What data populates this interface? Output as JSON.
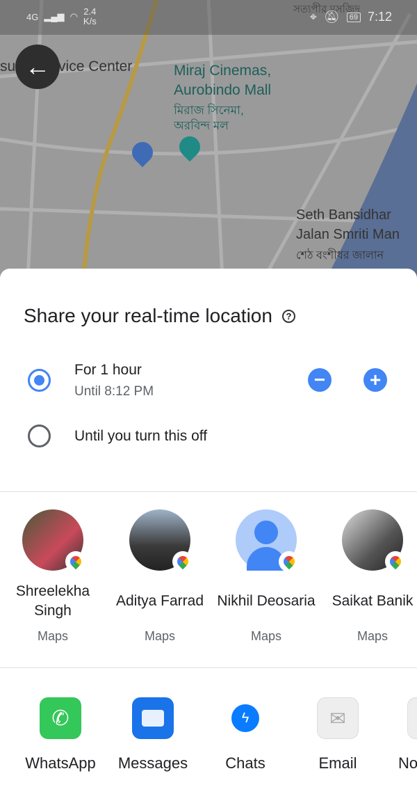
{
  "status_bar": {
    "network": "4G",
    "speed": "2.4",
    "speed_unit": "K/s",
    "battery": "69",
    "time": "7:12"
  },
  "map": {
    "labels": [
      "sung Service Center",
      "Miraj Cinemas,",
      "Aurobindo Mall",
      "মিরাজ সিনেমা,",
      "অরবিন্দ মল",
      "Seth Bansidhar",
      "Jalan Smriti Man",
      "শেঠ বংশীধর জালান",
      "সত্যপীর মসজিদ"
    ]
  },
  "sheet": {
    "title": "Share your real-time location",
    "options": [
      {
        "label": "For 1 hour",
        "sublabel": "Until 8:12 PM",
        "selected": true
      },
      {
        "label": "Until you turn this off",
        "selected": false
      }
    ],
    "contacts": [
      {
        "name": "Shreelekha Singh",
        "app": "Maps"
      },
      {
        "name": "Aditya Farrad",
        "app": "Maps"
      },
      {
        "name": "Nikhil Deosaria",
        "app": "Maps"
      },
      {
        "name": "Saikat Banik",
        "app": "Maps"
      }
    ],
    "apps": [
      {
        "name": "WhatsApp",
        "color": "#34c759"
      },
      {
        "name": "Messages",
        "color": "#1a73e8"
      },
      {
        "name": "Chats",
        "color": "#0a7cff"
      },
      {
        "name": "Email",
        "color": "#eeeeee"
      },
      {
        "name": "No",
        "color": "#eeeeee"
      }
    ]
  }
}
